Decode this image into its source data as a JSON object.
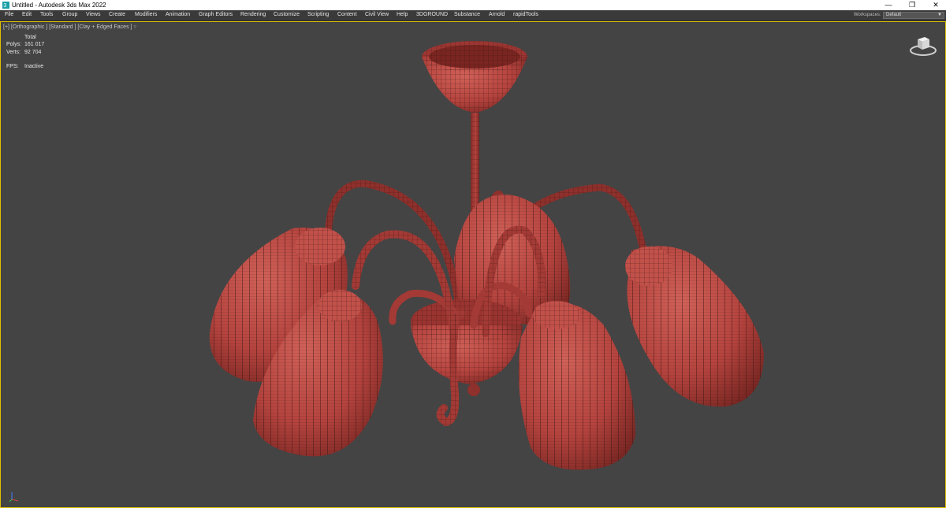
{
  "window": {
    "title": "Untitled - Autodesk 3ds Max 2022",
    "app_icon": "3ds-max-icon",
    "controls": [
      "minimize-icon",
      "restore-icon",
      "close-icon"
    ]
  },
  "menu": {
    "items": [
      "File",
      "Edit",
      "Tools",
      "Group",
      "Views",
      "Create",
      "Modifiers",
      "Animation",
      "Graph Editors",
      "Rendering",
      "Customize",
      "Scripting",
      "Content",
      "Civil View",
      "Help",
      "3DGROUND",
      "Substance",
      "Arnold",
      "rapidTools"
    ],
    "workspaces_label": "Workspaces:",
    "workspaces_value": "Default"
  },
  "viewport": {
    "label_plus": "[+]",
    "label_view": "[Orthographic ]",
    "label_shading": "[Standard ]",
    "label_style": "[Clay + Edged Faces ]",
    "filter_icon": "filter-icon",
    "stats": {
      "total_label": "Total",
      "polys_label": "Polys:",
      "polys_value": "161 017",
      "verts_label": "Verts:",
      "verts_value": "92 704",
      "fps_label": "FPS:",
      "fps_value": "Inactive"
    },
    "colors": {
      "background": "#444444",
      "mesh": "#b5433e",
      "wire": "#3a1513",
      "border": "#e0c000"
    }
  }
}
